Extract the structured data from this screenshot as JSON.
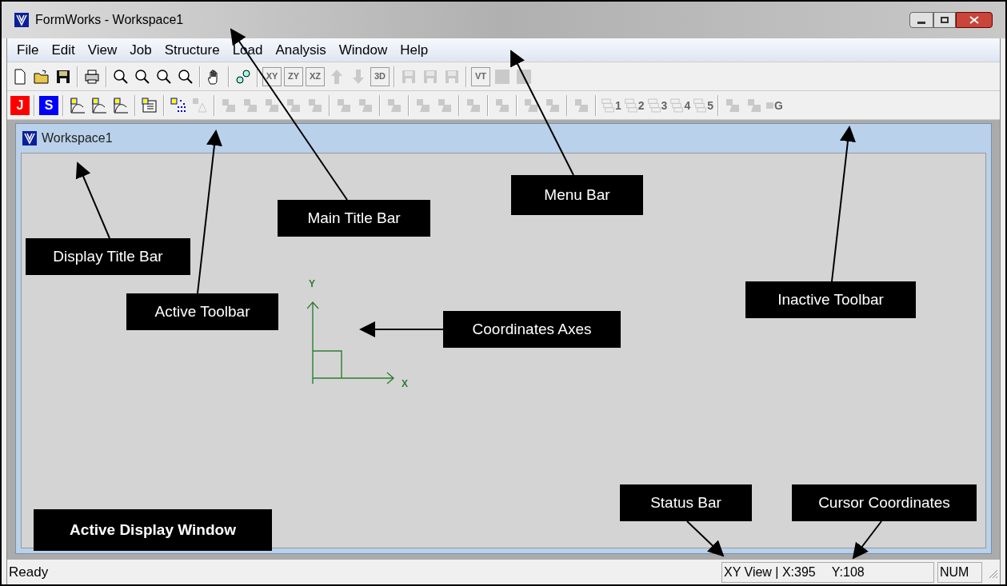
{
  "window": {
    "title": "FormWorks - Workspace1"
  },
  "menu": [
    "File",
    "Edit",
    "View",
    "Job",
    "Structure",
    "Load",
    "Analysis",
    "Window",
    "Help"
  ],
  "toolbars": [
    [
      {
        "kind": "page",
        "disabled": false
      },
      {
        "kind": "folder",
        "disabled": false
      },
      {
        "kind": "disk",
        "disabled": false
      },
      {
        "kind": "separator"
      },
      {
        "kind": "printer",
        "disabled": false
      },
      {
        "kind": "separator"
      },
      {
        "kind": "magnifier",
        "disabled": false
      },
      {
        "kind": "magnifier",
        "disabled": false
      },
      {
        "kind": "magnifier",
        "disabled": false
      },
      {
        "kind": "magnifier",
        "disabled": false
      },
      {
        "kind": "separator"
      },
      {
        "kind": "hand",
        "disabled": false
      },
      {
        "kind": "separator"
      },
      {
        "kind": "link",
        "disabled": false
      },
      {
        "kind": "separator"
      },
      {
        "kind": "text",
        "label": "XY",
        "disabled": true
      },
      {
        "kind": "text",
        "label": "ZY",
        "disabled": true
      },
      {
        "kind": "text",
        "label": "XZ",
        "disabled": true
      },
      {
        "kind": "arrowup",
        "disabled": true
      },
      {
        "kind": "arrowdown",
        "disabled": true
      },
      {
        "kind": "text",
        "label": "3D",
        "disabled": true
      },
      {
        "kind": "separator"
      },
      {
        "kind": "disk",
        "disabled": true
      },
      {
        "kind": "disk",
        "disabled": true
      },
      {
        "kind": "disk",
        "disabled": true
      },
      {
        "kind": "separator"
      },
      {
        "kind": "text",
        "label": "VT",
        "disabled": true
      },
      {
        "kind": "square",
        "disabled": true
      },
      {
        "kind": "square",
        "disabled": true
      }
    ],
    [
      {
        "kind": "letter",
        "label": "J",
        "color": "#ff0000",
        "disabled": false
      },
      {
        "kind": "separator"
      },
      {
        "kind": "letter",
        "label": "S",
        "color": "#0000ff",
        "disabled": false
      },
      {
        "kind": "separator"
      },
      {
        "kind": "curve",
        "disabled": false
      },
      {
        "kind": "curve",
        "disabled": false
      },
      {
        "kind": "curve",
        "disabled": false
      },
      {
        "kind": "separator"
      },
      {
        "kind": "grid",
        "disabled": false
      },
      {
        "kind": "separator"
      },
      {
        "kind": "dots",
        "disabled": false
      },
      {
        "kind": "triangle",
        "disabled": true
      },
      {
        "kind": "separator"
      },
      {
        "kind": "shape",
        "disabled": true
      },
      {
        "kind": "shape",
        "disabled": true
      },
      {
        "kind": "shape",
        "disabled": true
      },
      {
        "kind": "shape",
        "disabled": true
      },
      {
        "kind": "shape",
        "disabled": true
      },
      {
        "kind": "separator"
      },
      {
        "kind": "shape",
        "disabled": true
      },
      {
        "kind": "shape",
        "disabled": true
      },
      {
        "kind": "separator"
      },
      {
        "kind": "shape",
        "disabled": true
      },
      {
        "kind": "separator"
      },
      {
        "kind": "shape",
        "disabled": true
      },
      {
        "kind": "shape",
        "disabled": true
      },
      {
        "kind": "separator"
      },
      {
        "kind": "shape",
        "disabled": true
      },
      {
        "kind": "separator"
      },
      {
        "kind": "shape",
        "disabled": true
      },
      {
        "kind": "separator"
      },
      {
        "kind": "shape",
        "disabled": true
      },
      {
        "kind": "shape",
        "disabled": true
      },
      {
        "kind": "separator"
      },
      {
        "kind": "shape",
        "disabled": true
      },
      {
        "kind": "separator"
      },
      {
        "kind": "stack",
        "label": "1",
        "disabled": true
      },
      {
        "kind": "stack",
        "label": "2",
        "disabled": true
      },
      {
        "kind": "stack",
        "label": "3",
        "disabled": true
      },
      {
        "kind": "stack",
        "label": "4",
        "disabled": true
      },
      {
        "kind": "stack",
        "label": "5",
        "disabled": true
      },
      {
        "kind": "separator"
      },
      {
        "kind": "shape",
        "disabled": true
      },
      {
        "kind": "shape",
        "disabled": true
      },
      {
        "kind": "tagged",
        "label": "G",
        "disabled": true
      }
    ]
  ],
  "display": {
    "title": "Workspace1",
    "axes": {
      "y": "Y",
      "x": "X"
    }
  },
  "status_bar": {
    "message": "Ready",
    "view": "XY View",
    "x": "| X:395",
    "y": "Y:108",
    "num": "NUM"
  },
  "annotations": [
    {
      "text": "Main Title Bar",
      "bold": false
    },
    {
      "text": "Menu Bar",
      "bold": false
    },
    {
      "text": "Display Title Bar",
      "bold": false
    },
    {
      "text": "Active Toolbar",
      "bold": false
    },
    {
      "text": "Coordinates Axes",
      "bold": false
    },
    {
      "text": "Inactive Toolbar",
      "bold": false
    },
    {
      "text": "Status Bar",
      "bold": false
    },
    {
      "text": "Cursor Coordinates",
      "bold": false
    },
    {
      "text": "Active Display Window",
      "bold": true
    }
  ]
}
